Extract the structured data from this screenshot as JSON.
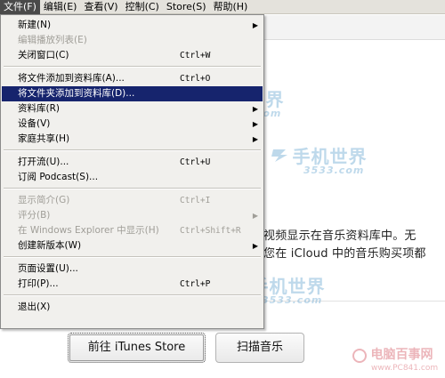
{
  "menubar": {
    "items": [
      {
        "label": "文件(F)",
        "active": true
      },
      {
        "label": "编辑(E)",
        "active": false
      },
      {
        "label": "查看(V)",
        "active": false
      },
      {
        "label": "控制(C)",
        "active": false
      },
      {
        "label": "Store(S)",
        "active": false
      },
      {
        "label": "帮助(H)",
        "active": false
      }
    ]
  },
  "file_menu": {
    "items": [
      {
        "label": "新建(N)",
        "shortcut": "",
        "submenu": true,
        "disabled": false
      },
      {
        "label": "编辑播放列表(E)",
        "shortcut": "",
        "submenu": false,
        "disabled": true
      },
      {
        "label": "关闭窗口(C)",
        "shortcut": "Ctrl+W",
        "submenu": false,
        "disabled": false
      },
      {
        "label": "将文件添加到资料库(A)...",
        "shortcut": "Ctrl+O",
        "submenu": false,
        "disabled": false
      },
      {
        "label": "将文件夹添加到资料库(D)...",
        "shortcut": "",
        "submenu": false,
        "disabled": false,
        "highlighted": true
      },
      {
        "label": "资料库(R)",
        "shortcut": "",
        "submenu": true,
        "disabled": false
      },
      {
        "label": "设备(V)",
        "shortcut": "",
        "submenu": true,
        "disabled": false
      },
      {
        "label": "家庭共享(H)",
        "shortcut": "",
        "submenu": true,
        "disabled": false
      },
      {
        "label": "打开流(U)...",
        "shortcut": "Ctrl+U",
        "submenu": false,
        "disabled": false
      },
      {
        "label": "订阅 Podcast(S)...",
        "shortcut": "",
        "submenu": false,
        "disabled": false
      },
      {
        "label": "显示简介(G)",
        "shortcut": "Ctrl+I",
        "submenu": false,
        "disabled": true
      },
      {
        "label": "评分(B)",
        "shortcut": "",
        "submenu": true,
        "disabled": true
      },
      {
        "label": "在 Windows Explorer 中显示(H)",
        "shortcut": "Ctrl+Shift+R",
        "submenu": false,
        "disabled": true
      },
      {
        "label": "创建新版本(W)",
        "shortcut": "",
        "submenu": true,
        "disabled": false
      },
      {
        "label": "页面设置(U)...",
        "shortcut": "",
        "submenu": false,
        "disabled": false
      },
      {
        "label": "打印(P)...",
        "shortcut": "Ctrl+P",
        "submenu": false,
        "disabled": false
      },
      {
        "label": "退出(X)",
        "shortcut": "",
        "submenu": false,
        "disabled": false
      }
    ]
  },
  "content": {
    "line1": "视频显示在音乐资料库中。无",
    "line2": "您在 iCloud 中的音乐购买项都",
    "go_store_label": "前往 iTunes Store",
    "scan_music_label": "扫描音乐"
  },
  "watermarks": {
    "brand": "手机世界",
    "url": "3533.com",
    "corner_name": "电脑百事网",
    "corner_site": "www.PC841.com"
  },
  "colors": {
    "menu_highlight": "#16246d",
    "menu_background": "#f1f0ed",
    "menubar_background": "#e4e2dc"
  }
}
